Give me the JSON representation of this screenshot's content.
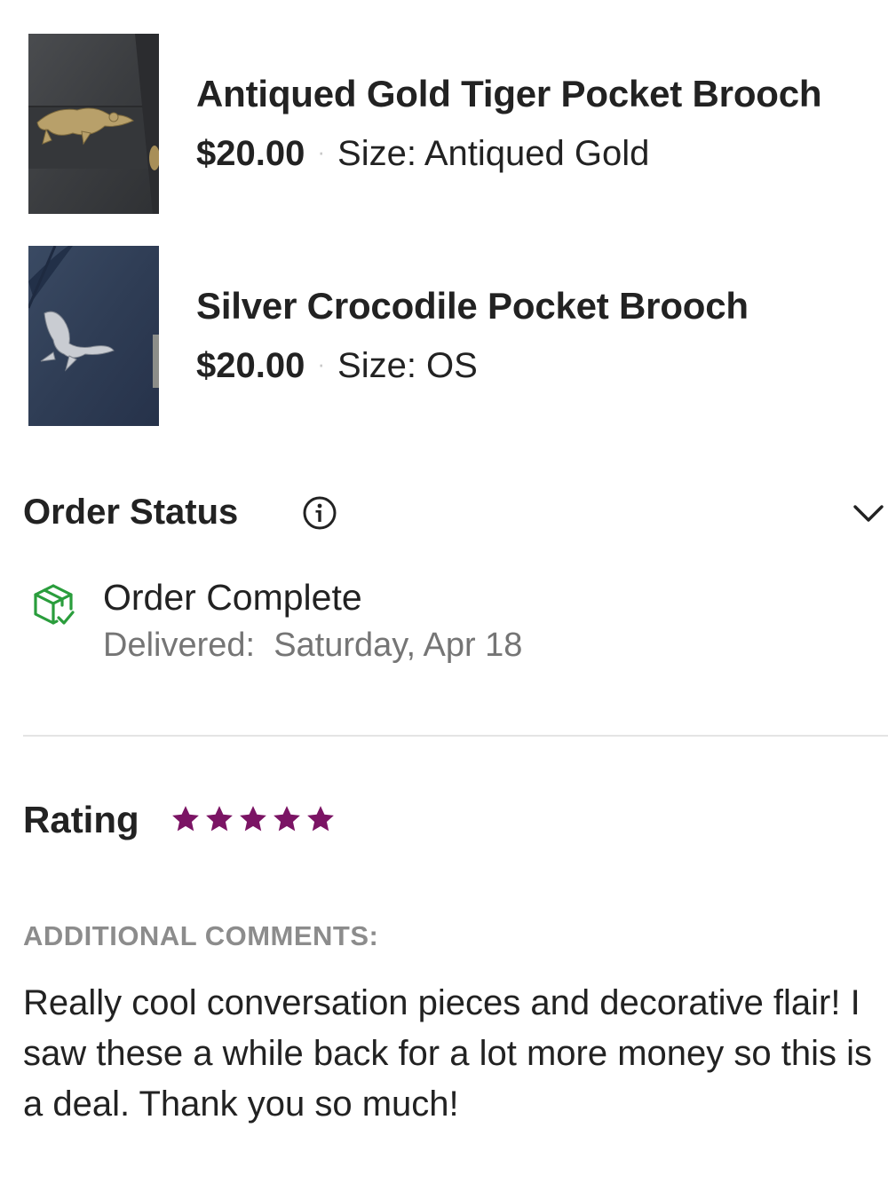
{
  "items": [
    {
      "title": "Antiqued Gold Tiger Pocket Brooch",
      "price": "$20.00",
      "separator": "·",
      "size": "Size: Antiqued Gold",
      "image_icon": "tiger-brooch-photo"
    },
    {
      "title": "Silver Crocodile Pocket Brooch",
      "price": "$20.00",
      "separator": "·",
      "size": "Size: OS",
      "image_icon": "crocodile-brooch-photo"
    }
  ],
  "order_status": {
    "title": "Order Status",
    "info_icon": "info-icon",
    "toggle_icon": "chevron-down-icon",
    "status": "Order Complete",
    "delivered": "Delivered:  Saturday, Apr 18",
    "status_icon": "box-check-icon",
    "status_color": "#2a9d3c"
  },
  "rating": {
    "label": "Rating",
    "stars": 5,
    "max": 5,
    "star_color": "#7b1464"
  },
  "comments": {
    "label": "ADDITIONAL COMMENTS:",
    "text": "Really cool conversation pieces and decorative flair! I saw these a while back for a lot more money so this is a deal. Thank you so much!"
  }
}
